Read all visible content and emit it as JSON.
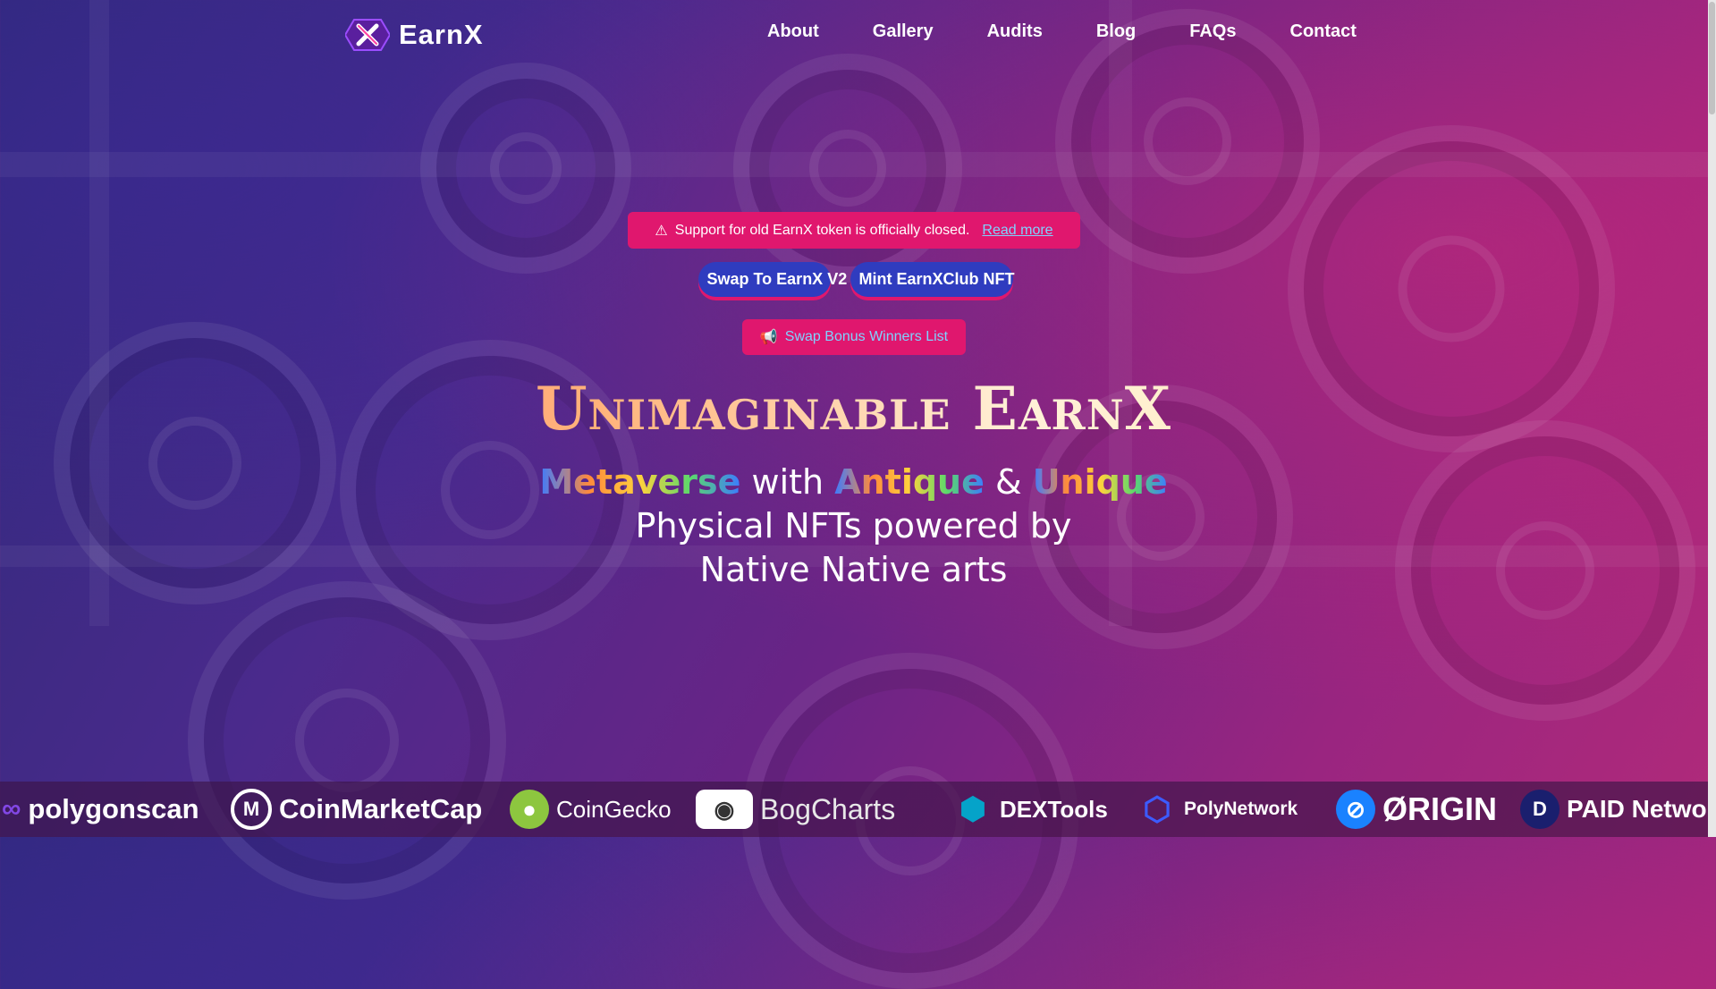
{
  "header": {
    "brand": "EarnX",
    "nav": [
      "About",
      "Gallery",
      "Audits",
      "Blog",
      "FAQs",
      "Contact"
    ]
  },
  "notice": {
    "icon": "warning-icon",
    "text": "Support for old EarnX token is officially closed.",
    "link": "Read more"
  },
  "buttons": {
    "swap": "Swap To EarnX V2",
    "mint": "Mint EarnXClub NFT",
    "bonus": "Swap Bonus Winners List",
    "bonus_icon": "megaphone-icon"
  },
  "hero": {
    "title": "Unimaginable EarnX",
    "line1_a": "Metaverse",
    "line1_b": " with ",
    "line1_c": "Antique",
    "line1_d": " & ",
    "line1_e": "Unique",
    "line2": "Physical NFTs powered by",
    "line3": "Native Native arts"
  },
  "partners": [
    "polygonscan",
    "CoinMarketCap",
    "CoinGecko",
    "BogCharts",
    "DEXTools",
    "PolyNetwork",
    "ØRIGIN",
    "PAID Network"
  ],
  "colors": {
    "accent_pink": "#e0176e",
    "accent_blue": "#2f3cbf",
    "link_cyan": "#7fd3ff"
  }
}
